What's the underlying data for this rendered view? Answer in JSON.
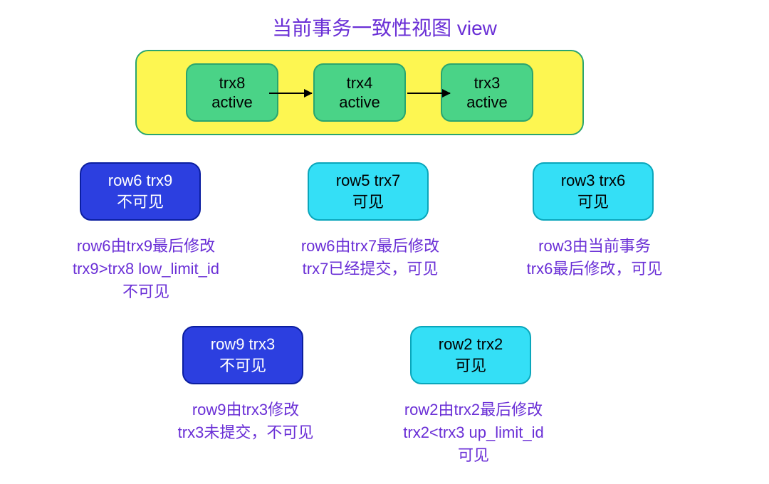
{
  "title": "当前事务一致性视图 view",
  "active": {
    "items": [
      {
        "name": "trx8",
        "state": "active"
      },
      {
        "name": "trx4",
        "state": "active"
      },
      {
        "name": "trx3",
        "state": "active"
      }
    ]
  },
  "nodes": {
    "r6": {
      "l1": "row6 trx9",
      "l2": "不可见"
    },
    "r5": {
      "l1": "row5 trx7",
      "l2": "可见"
    },
    "r3": {
      "l1": "row3 trx6",
      "l2": "可见"
    },
    "r9": {
      "l1": "row9 trx3",
      "l2": "不可见"
    },
    "r2": {
      "l1": "row2 trx2",
      "l2": "可见"
    }
  },
  "notes": {
    "r6": "row6由trx9最后修改\ntrx9>trx8 low_limit_id\n不可见",
    "r5": "row6由trx7最后修改\ntrx7已经提交，可见",
    "r3": "row3由当前事务\ntrx6最后修改，可见",
    "r9": "row9由trx3修改\ntrx3未提交，不可见",
    "r2": "row2由trx2最后修改\ntrx2<trx3 up_limit_id\n可见"
  },
  "chart_data": {
    "type": "diagram",
    "title": "当前事务一致性视图 view",
    "active_transactions": [
      "trx8",
      "trx4",
      "trx3"
    ],
    "active_order_arrows": [
      "trx8→trx4",
      "trx4→trx3"
    ],
    "low_limit_id_ref": "trx8",
    "up_limit_id_ref": "trx3",
    "rows": [
      {
        "row": "row6",
        "last_modified_by": "trx9",
        "visible": false,
        "reason": "trx9>trx8 low_limit_id"
      },
      {
        "row": "row5",
        "last_modified_by": "trx7",
        "visible": true,
        "reason": "trx7已经提交"
      },
      {
        "row": "row3",
        "last_modified_by": "trx6",
        "visible": true,
        "reason": "当前事务trx6最后修改"
      },
      {
        "row": "row9",
        "last_modified_by": "trx3",
        "visible": false,
        "reason": "trx3未提交"
      },
      {
        "row": "row2",
        "last_modified_by": "trx2",
        "visible": true,
        "reason": "trx2<trx3 up_limit_id"
      }
    ]
  }
}
